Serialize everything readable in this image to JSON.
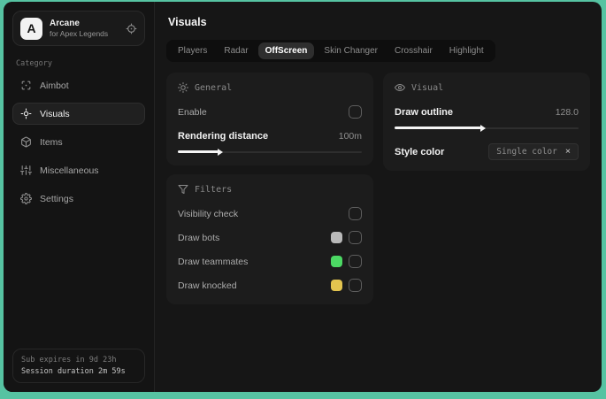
{
  "colors": {
    "desktop_background": "#56c3a2",
    "bots_swatch": "#b9b9b9",
    "teammates_swatch": "#4cd964",
    "knocked_swatch": "#e3c44f"
  },
  "sidebar": {
    "brand": {
      "initial": "A",
      "name": "Arcane",
      "subtitle": "for Apex Legends"
    },
    "category_label": "Category",
    "items": [
      {
        "label": "Aimbot",
        "icon": "crosshair-scan-icon",
        "selected": false
      },
      {
        "label": "Visuals",
        "icon": "focus-icon",
        "selected": true
      },
      {
        "label": "Items",
        "icon": "cube-icon",
        "selected": false
      },
      {
        "label": "Miscellaneous",
        "icon": "sliders-icon",
        "selected": false
      },
      {
        "label": "Settings",
        "icon": "gear-icon",
        "selected": false
      }
    ],
    "footer": {
      "line1": "Sub expires in 9d 23h",
      "line2": "Session duration 2m 59s"
    }
  },
  "main": {
    "title": "Visuals",
    "tabs": [
      {
        "label": "Players",
        "selected": false
      },
      {
        "label": "Radar",
        "selected": false
      },
      {
        "label": "OffScreen",
        "selected": true
      },
      {
        "label": "Skin Changer",
        "selected": false
      },
      {
        "label": "Crosshair",
        "selected": false
      },
      {
        "label": "Highlight",
        "selected": false
      }
    ],
    "panels": {
      "general": {
        "title": "General",
        "enable_label": "Enable",
        "enable_checked": false,
        "rendering_distance_label": "Rendering distance",
        "rendering_distance_value": "100m",
        "rendering_distance_fill_pct": 22
      },
      "visual": {
        "title": "Visual",
        "draw_outline_label": "Draw outline",
        "draw_outline_value": "128.0",
        "draw_outline_fill_pct": 47,
        "style_color_label": "Style color",
        "style_color_value": "Single color",
        "clear_glyph": "×"
      },
      "filters": {
        "title": "Filters",
        "rows": [
          {
            "label": "Visibility check",
            "checked": false
          },
          {
            "label": "Draw bots",
            "swatch": "#b9b9b9",
            "checked": false
          },
          {
            "label": "Draw teammates",
            "swatch": "#4cd964",
            "checked": false
          },
          {
            "label": "Draw knocked",
            "swatch": "#e3c44f",
            "checked": false
          }
        ]
      }
    }
  }
}
